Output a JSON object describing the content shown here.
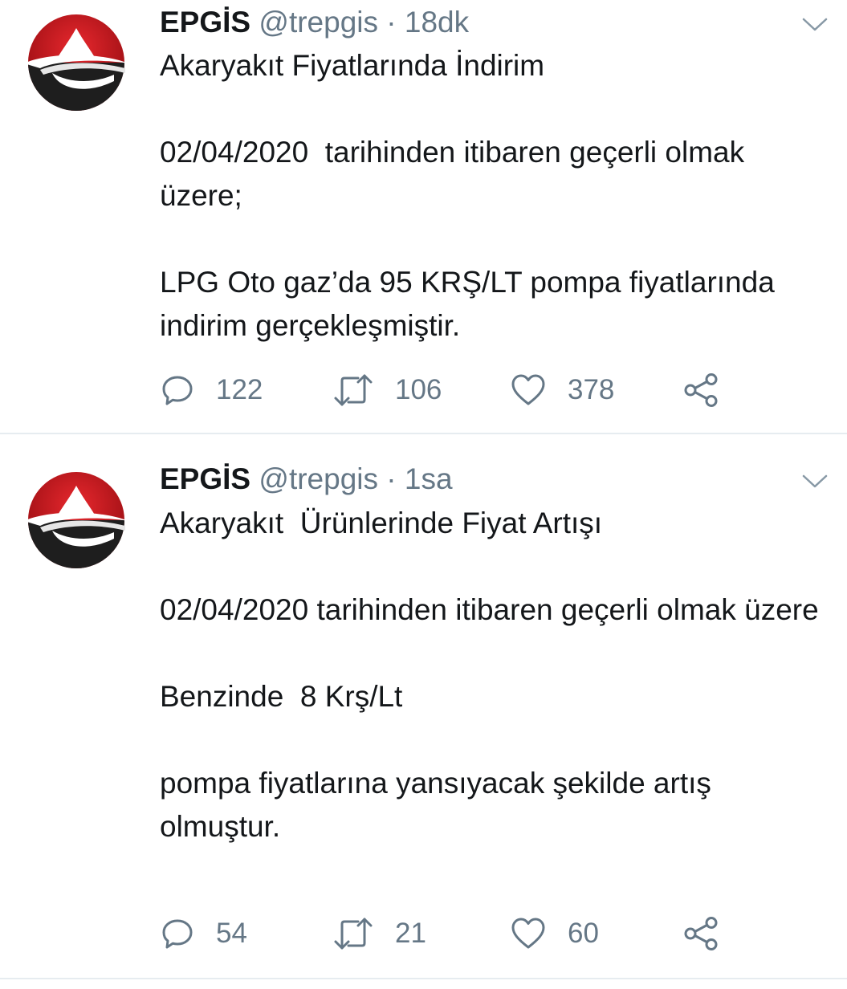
{
  "tweets": [
    {
      "author_name": "EPGİS",
      "handle": "@trepgis",
      "separator": "·",
      "time": "18dk",
      "paragraphs": [
        "Akaryakıt Fiyatlarında İndirim",
        "02/04/2020  tarihinden itibaren geçerli olmak üzere;",
        "LPG Oto gaz’da 95 KRŞ/LT pompa fiyatlarında indirim gerçekleşmiştir."
      ],
      "reply_count": "122",
      "retweet_count": "106",
      "like_count": "378"
    },
    {
      "author_name": "EPGİS",
      "handle": "@trepgis",
      "separator": "·",
      "time": "1sa",
      "paragraphs": [
        "Akaryakıt  Ürünlerinde Fiyat Artışı",
        "02/04/2020 tarihinden itibaren geçerli olmak üzere",
        "Benzinde  8 Krş/Lt",
        "pompa fiyatlarına yansıyacak şekilde artış olmuştur."
      ],
      "reply_count": "54",
      "retweet_count": "21",
      "like_count": "60"
    }
  ],
  "icons": {
    "avatar": "epgis-logo",
    "menu": "chevron-down-icon",
    "reply": "reply-icon",
    "retweet": "retweet-icon",
    "like": "heart-icon",
    "share": "share-icon"
  },
  "colors": {
    "text": "#14171a",
    "secondary": "#657786",
    "divider": "#e6ecf0",
    "logo_red": "#c4161c",
    "logo_dark": "#1e1e1e"
  }
}
